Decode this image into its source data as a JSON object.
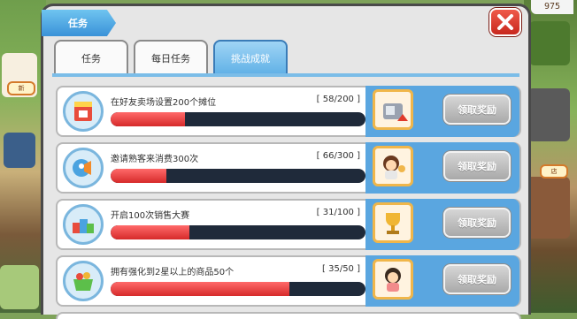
{
  "window": {
    "title": "任务",
    "close_icon": "close-icon"
  },
  "background": {
    "counter": "975",
    "chip_labels": [
      "新",
      "店"
    ]
  },
  "tabs": [
    {
      "label": "任务",
      "active": false
    },
    {
      "label": "每日任务",
      "active": false
    },
    {
      "label": "挑战成就",
      "active": true
    }
  ],
  "achievements": [
    {
      "name": "在好友卖场设置200个摊位",
      "current": 58,
      "total": 200,
      "count_text": "[ 58/200 ]",
      "progress": 0.29,
      "icon": "stall-icon",
      "reward_icon": "reward-appliance-icon",
      "claim_label": "领取奖励"
    },
    {
      "name": "邀请熟客来消费300次",
      "current": 66,
      "total": 300,
      "count_text": "[ 66/300 ]",
      "progress": 0.22,
      "icon": "megaphone-icon",
      "reward_icon": "reward-character-icon",
      "claim_label": "领取奖励"
    },
    {
      "name": "开启100次销售大赛",
      "current": 31,
      "total": 100,
      "count_text": "[ 31/100 ]",
      "progress": 0.31,
      "icon": "blocks-icon",
      "reward_icon": "reward-trophy-icon",
      "claim_label": "领取奖励"
    },
    {
      "name": "拥有强化到2星以上的商品50个",
      "current": 35,
      "total": 50,
      "count_text": "[ 35/50 ]",
      "progress": 0.7,
      "icon": "basket-icon",
      "reward_icon": "reward-girl-icon",
      "claim_label": "领取奖励"
    }
  ],
  "colors": {
    "accent": "#5aa6e0",
    "progress": "#d62a2a",
    "bar_track": "#1f2a3a",
    "close": "#d8352a"
  }
}
